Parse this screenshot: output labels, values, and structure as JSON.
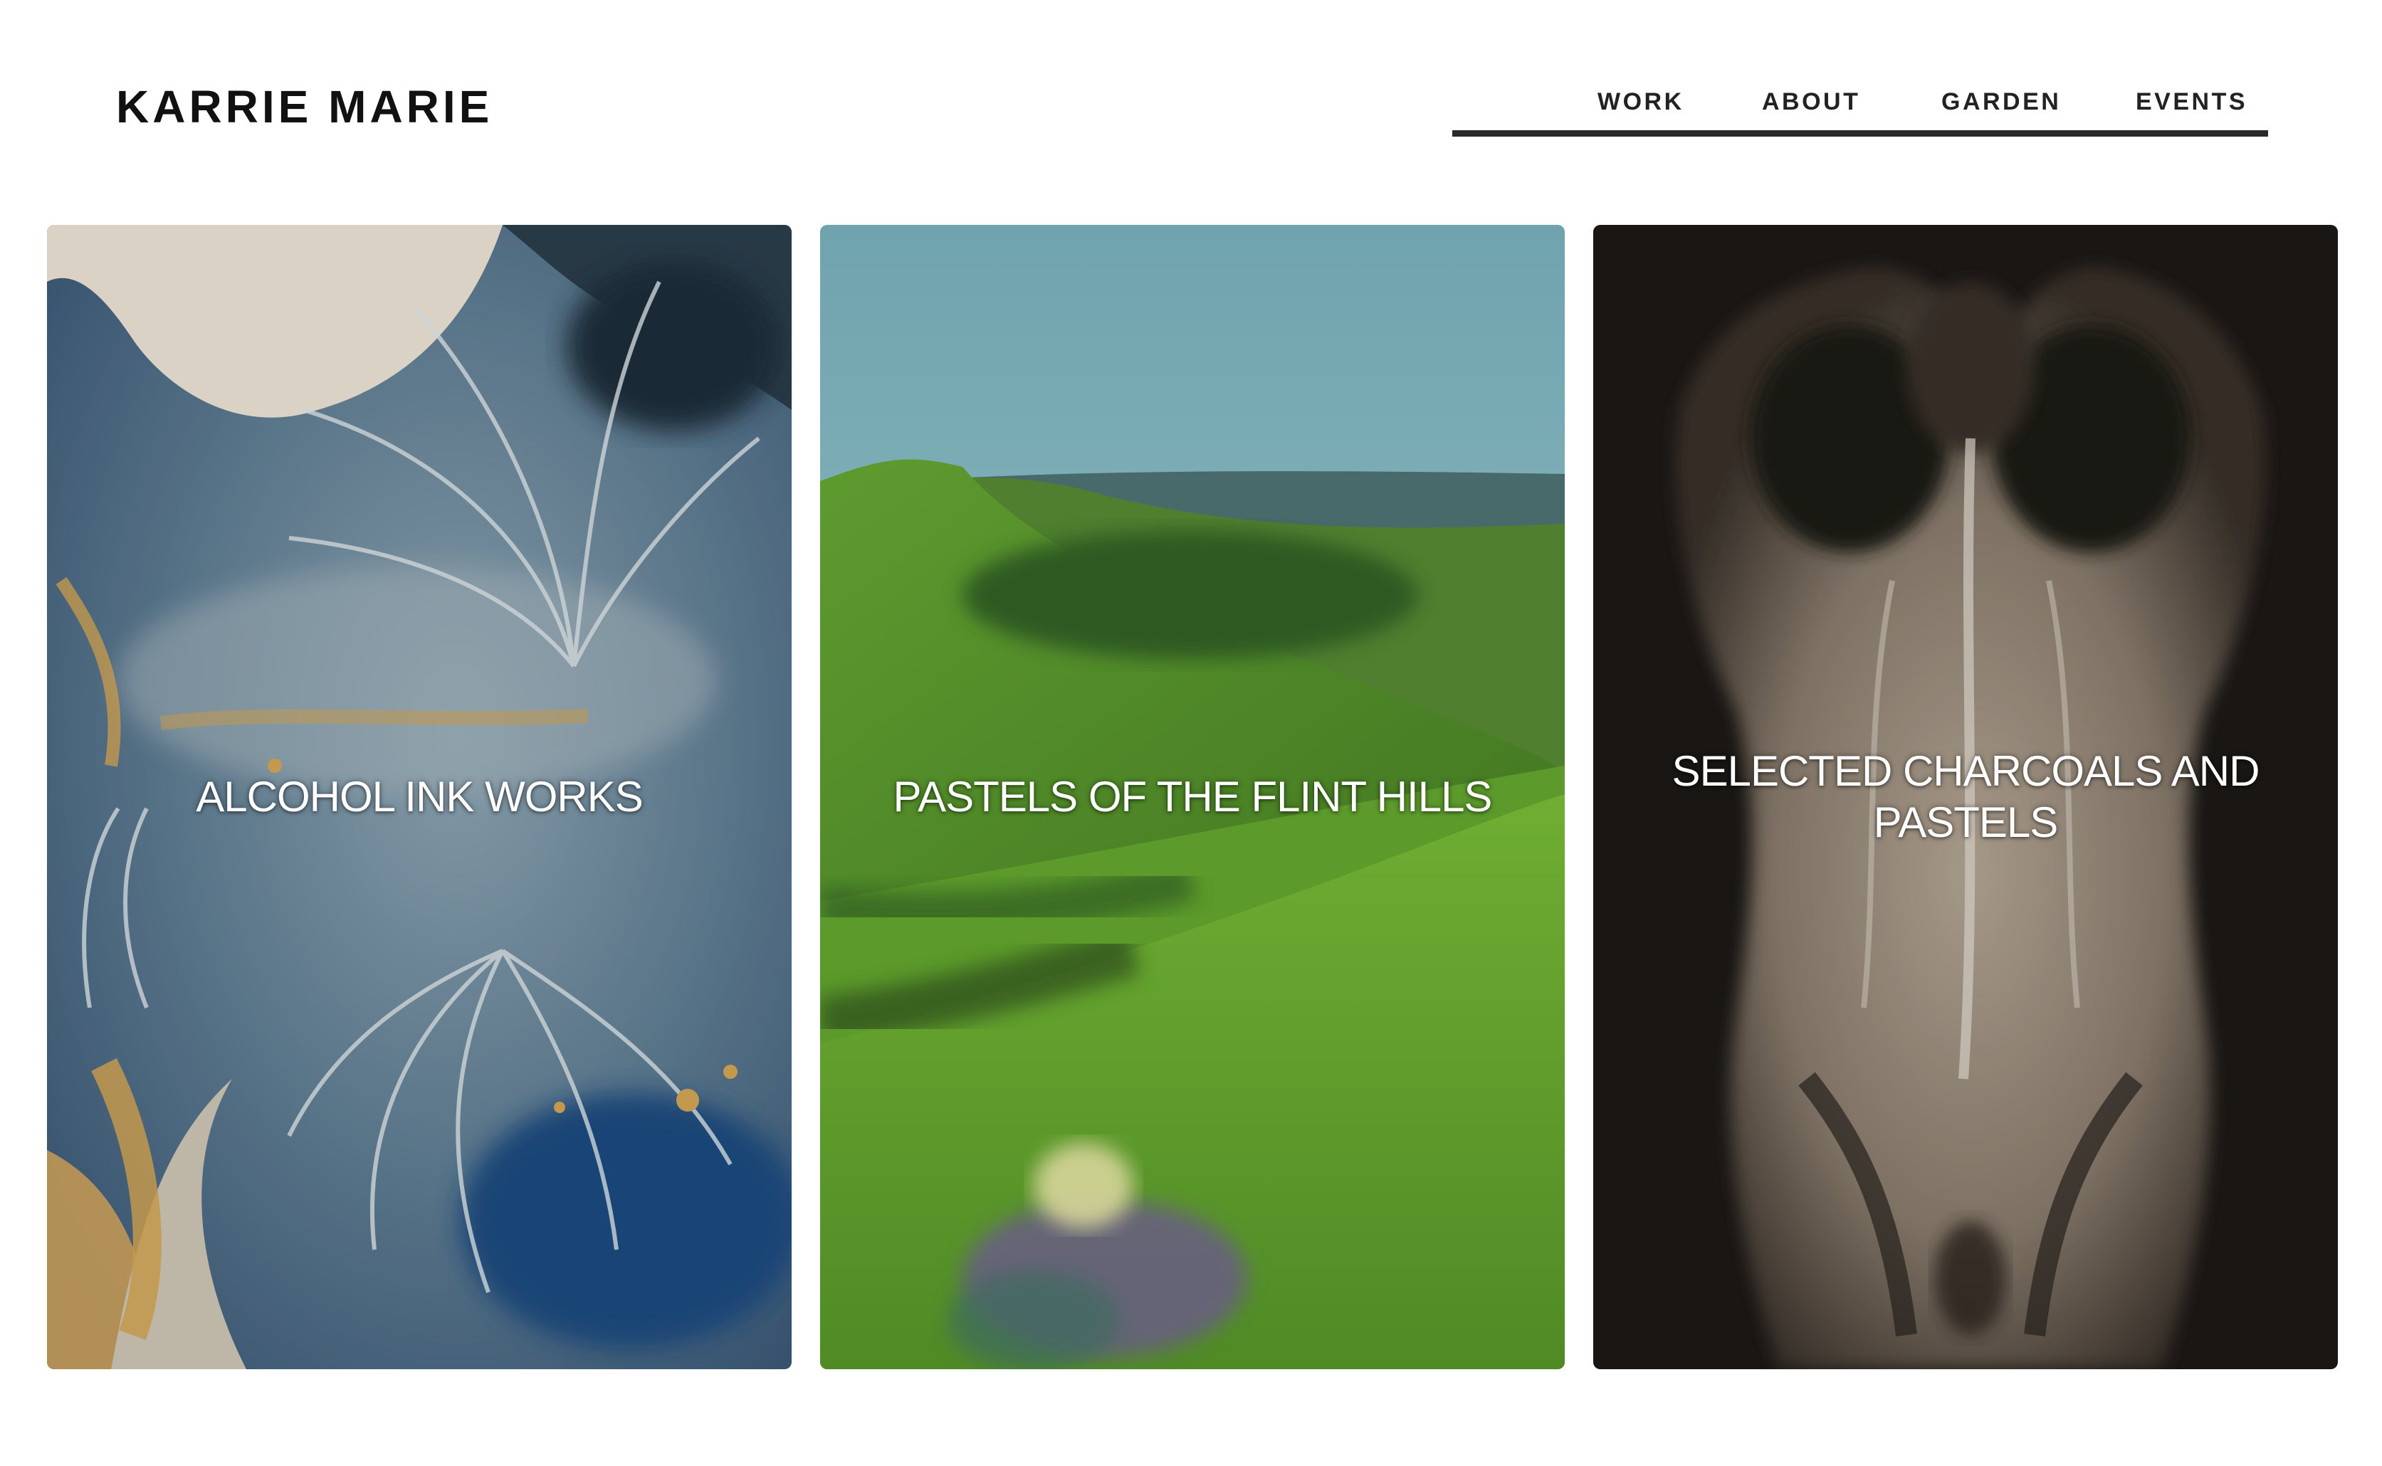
{
  "header": {
    "site_title": "KARRIE MARIE",
    "nav": [
      {
        "label": "WORK"
      },
      {
        "label": "ABOUT"
      },
      {
        "label": "GARDEN"
      },
      {
        "label": "EVENTS"
      }
    ]
  },
  "gallery": {
    "tiles": [
      {
        "label": "ALCOHOL INK WORKS"
      },
      {
        "label": "PASTELS OF THE FLINT HILLS"
      },
      {
        "label": "SELECTED CHARCOALS AND PASTELS"
      }
    ]
  },
  "colors": {
    "background": "#ffffff",
    "text": "#111111",
    "nav_underline": "#2a2a2a",
    "tile_label": "#ffffff"
  }
}
